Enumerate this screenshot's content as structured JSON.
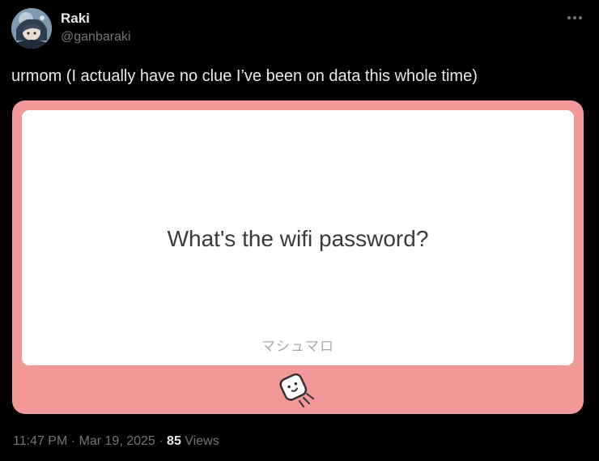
{
  "tweet": {
    "author": {
      "display_name": "Raki",
      "handle": "@ganbaraki"
    },
    "more_icon": "more-horizontal-icon",
    "text": "urmom (I actually have no clue I’ve been on data this whole time)",
    "card": {
      "question": "What's the wifi password?",
      "brand": "マシュマロ",
      "logo_icon": "marshmallow-icon",
      "colors": {
        "frame": "#f29898",
        "inner": "#ffffff"
      }
    },
    "meta": {
      "time": "11:47 PM",
      "separator": "·",
      "date": "Mar 19, 2025",
      "views_count": "85",
      "views_label": "Views"
    }
  },
  "colors": {
    "background": "#000000",
    "primary_text": "#e7e9ea",
    "secondary_text": "#71767b"
  }
}
